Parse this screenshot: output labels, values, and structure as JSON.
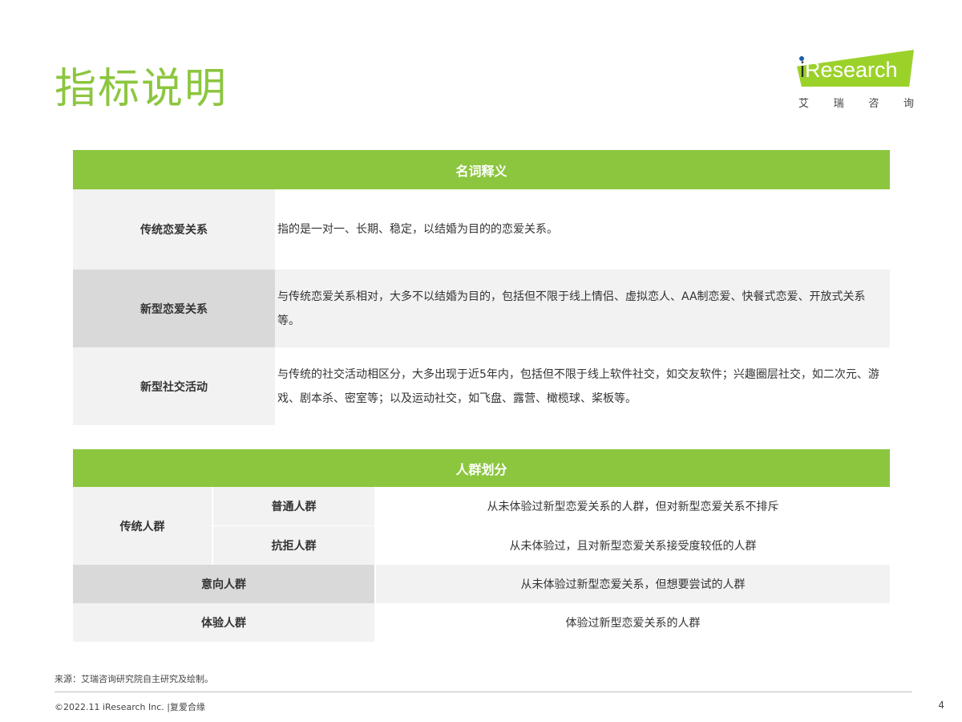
{
  "header": {
    "title": "指标说明",
    "logo_i": "i",
    "logo_word": "Research",
    "logo_sub": [
      "艾",
      "瑞",
      "咨",
      "询"
    ]
  },
  "terms": {
    "heading": "名词释义",
    "rows": [
      {
        "term": "传统恋爱关系",
        "definition": "指的是一对一、长期、稳定，以结婚为目的的恋爱关系。"
      },
      {
        "term": "新型恋爱关系",
        "definition": "与传统恋爱关系相对，大多不以结婚为目的，包括但不限于线上情侣、虚拟恋人、AA制恋爱、快餐式恋爱、开放式关系等。"
      },
      {
        "term": "新型社交活动",
        "definition": "与传统的社交活动相区分，大多出现于近5年内，包括但不限于线上软件社交，如交友软件；兴趣圈层社交，如二次元、游戏、剧本杀、密室等；以及运动社交，如飞盘、露营、橄榄球、桨板等。"
      }
    ]
  },
  "groups": {
    "heading": "人群划分",
    "traditional_label": "传统人群",
    "rows": [
      {
        "name": "普通人群",
        "description": "从未体验过新型恋爱关系的人群，但对新型恋爱关系不排斥"
      },
      {
        "name": "抗拒人群",
        "description": "从未体验过，且对新型恋爱关系接受度较低的人群"
      },
      {
        "name": "意向人群",
        "description": "从未体验过新型恋爱关系，但想要尝试的人群"
      },
      {
        "name": "体验人群",
        "description": "体验过新型恋爱关系的人群"
      }
    ]
  },
  "footer": {
    "source": "来源：艾瑞咨询研究院自主研究及绘制。",
    "copyright": "©2022.11 iResearch Inc. |复爱合缘",
    "page_number": "4"
  },
  "colors": {
    "accent_green": "#8cc63f",
    "logo_green": "#9bd22a"
  }
}
